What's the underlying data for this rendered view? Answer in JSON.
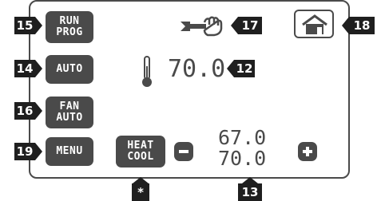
{
  "screen": {
    "buttons": {
      "run_prog": "RUN\nPROG",
      "auto": "AUTO",
      "fan_auto": "FAN\nAUTO",
      "menu": "MENU",
      "heat_cool": "HEAT\nCOOL"
    },
    "indoor_temperature": "70.0",
    "setpoint_heat": "67.0",
    "setpoint_cool": "70.0"
  },
  "callouts": {
    "run_prog": "15",
    "auto": "14",
    "fan_auto": "16",
    "menu": "19",
    "temperature": "12",
    "wrench": "17",
    "home": "18",
    "setpoints": "13",
    "heat_cool": "*"
  },
  "icons": {
    "wrench": "wrench-hand-icon",
    "home": "home-icon",
    "thermometer": "thermometer-icon",
    "minus": "minus-icon",
    "plus": "plus-icon"
  },
  "colors": {
    "lcd": "#4a4a4a",
    "callout": "#1f1f1f",
    "background": "#ffffff"
  }
}
